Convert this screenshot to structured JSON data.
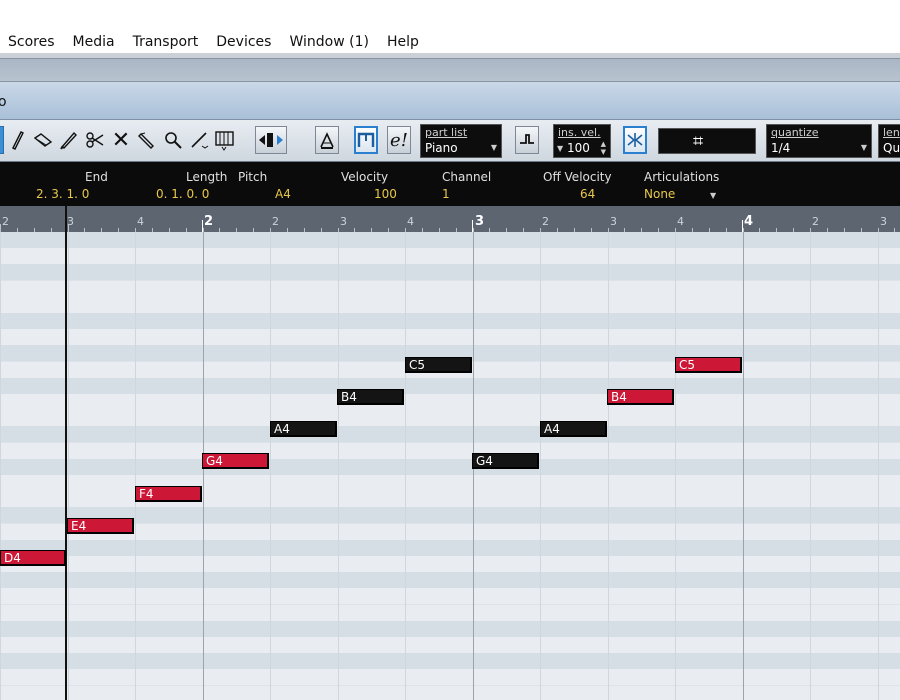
{
  "menu": [
    "Scores",
    "Media",
    "Transport",
    "Devices",
    "Window (1)",
    "Help"
  ],
  "window_title": "o",
  "toolbar": {
    "part_list_label": "part list",
    "part_list_value": "Piano",
    "ins_vel_label": "ins. vel.",
    "ins_vel_value": "100",
    "quantize_label": "quantize",
    "quantize_value": "1/4",
    "length_label": "len",
    "length_value": "Qu",
    "snap_symbol": "⌗"
  },
  "infoline": {
    "headers": {
      "end": "End",
      "length": "Length",
      "pitch": "Pitch",
      "velocity": "Velocity",
      "channel": "Channel",
      "off_velocity": "Off Velocity",
      "articulations": "Articulations"
    },
    "values": {
      "end": "2. 3. 1.   0",
      "length": "0. 1. 0.   0",
      "pitch": "A4",
      "velocity": "100",
      "channel": "1",
      "off_velocity": "64",
      "articulations": "None"
    }
  },
  "ruler": {
    "labels": [
      "2",
      "3",
      "4",
      "2",
      "2",
      "3",
      "4",
      "3",
      "2",
      "3",
      "4",
      "4",
      "2",
      "3"
    ]
  },
  "notes": [
    {
      "pitch": "D4",
      "state": "selected"
    },
    {
      "pitch": "E4",
      "state": "selected"
    },
    {
      "pitch": "F4",
      "state": "selected"
    },
    {
      "pitch": "G4",
      "state": "selected"
    },
    {
      "pitch": "A4",
      "state": "unselected"
    },
    {
      "pitch": "B4",
      "state": "unselected"
    },
    {
      "pitch": "C5",
      "state": "unselected"
    },
    {
      "pitch": "G4",
      "state": "unselected"
    },
    {
      "pitch": "A4",
      "state": "unselected"
    },
    {
      "pitch": "B4",
      "state": "selected"
    },
    {
      "pitch": "C5",
      "state": "selected"
    }
  ],
  "colors": {
    "selected_note": "#cc1836",
    "unselected_note": "#141414",
    "accent_blue": "#2b7fcf"
  }
}
